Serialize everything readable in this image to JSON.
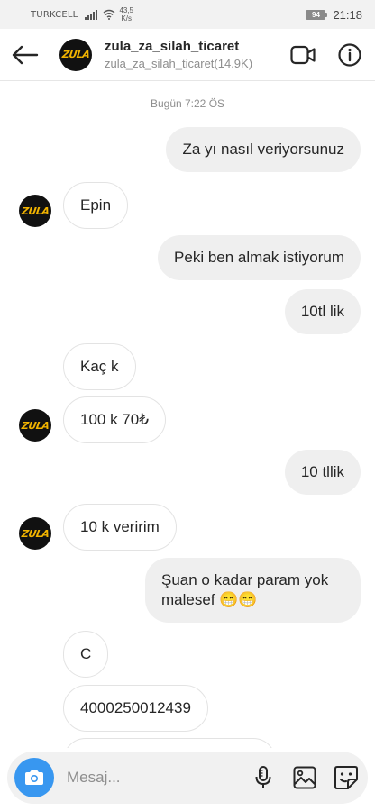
{
  "status": {
    "carrier": "TURKCELL",
    "speed_value": "43,5",
    "speed_unit": "K/s",
    "battery": "94",
    "time": "21:18"
  },
  "header": {
    "name": "zula_za_silah_ticaret",
    "subtitle": "zula_za_silah_ticaret(14.9K)",
    "avatar_text": "ZULA"
  },
  "chat": {
    "timestamp": "Bugün 7:22 ÖS",
    "messages": [
      {
        "side": "out",
        "text": "Za yı nasıl veriyorsunuz"
      },
      {
        "side": "in",
        "text": "Epin"
      },
      {
        "side": "out",
        "text": "Peki ben almak istiyorum"
      },
      {
        "side": "out",
        "text": "10tl lik"
      },
      {
        "side": "in",
        "text": "Kaç k"
      },
      {
        "side": "in",
        "text": "100 k 70₺"
      },
      {
        "side": "out",
        "text": "10 tllik"
      },
      {
        "side": "in",
        "text": "10 k veririm"
      },
      {
        "side": "out",
        "text": "Şuan o kadar param yok malesef 😁😁"
      },
      {
        "side": "in",
        "text": "C"
      },
      {
        "side": "in",
        "text": "4000250012439"
      }
    ]
  },
  "composer": {
    "placeholder": "Mesaj..."
  },
  "icons": {
    "back": "arrow-left-icon",
    "video": "video-call-icon",
    "info": "info-icon",
    "camera": "camera-icon",
    "mic": "microphone-icon",
    "gallery": "gallery-icon",
    "sticker": "sticker-icon"
  },
  "colors": {
    "accent": "#3897f0",
    "outgoing_bubble": "#efefef",
    "avatar_logo": "#f2b400"
  }
}
